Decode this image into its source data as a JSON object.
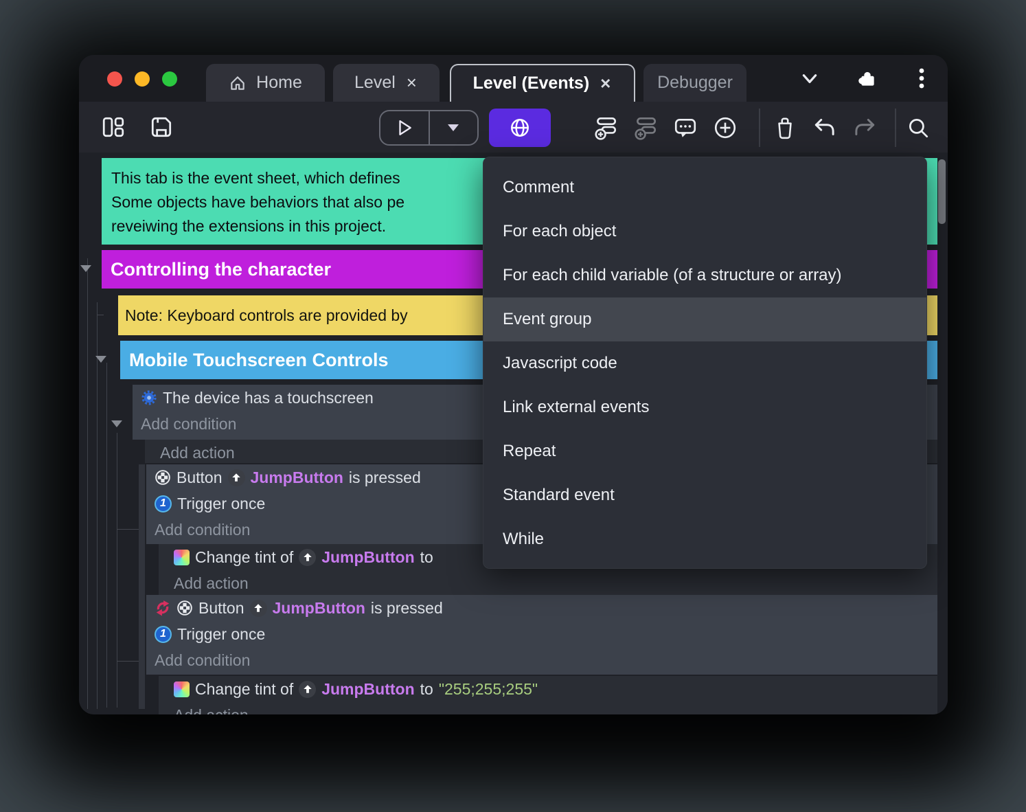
{
  "titlebar": {
    "tabs": [
      {
        "label": "Home"
      },
      {
        "label": "Level",
        "close": "×"
      },
      {
        "label": "Level (Events)",
        "close": "×"
      },
      {
        "label": "Debugger"
      }
    ]
  },
  "menu": {
    "items": [
      {
        "label": "Comment"
      },
      {
        "label": "For each object"
      },
      {
        "label": "For each child variable (of a structure or array)"
      },
      {
        "label": "Event group",
        "highlighted": true
      },
      {
        "label": "Javascript code"
      },
      {
        "label": "Link external events"
      },
      {
        "label": "Repeat"
      },
      {
        "label": "Standard event"
      },
      {
        "label": "While"
      }
    ]
  },
  "sheet": {
    "comment_lines": {
      "line1": "This tab is the event sheet, which defines",
      "line2": "Some objects have behaviors that also pe",
      "line3": "reveiwing the extensions in this project."
    },
    "group_controlling": "Controlling the character",
    "note": "Note: Keyboard controls are provided by",
    "group_mobile": "Mobile Touchscreen Controls",
    "labels": {
      "add_condition": "Add condition",
      "add_action": "Add action"
    },
    "touch_condition": "The device has a touchscreen",
    "button_condition": {
      "prefix": "Button",
      "object": "JumpButton",
      "suffix": "is pressed"
    },
    "trigger_once": "Trigger once",
    "trigger_badge": "1",
    "tint_action": {
      "prefix": "Change tint of",
      "object": "JumpButton",
      "to": "to",
      "value": "\"255;255;255\""
    }
  },
  "colors": {
    "comment_bg": "#4cdcb2",
    "group_controlling_bg": "#bf1fdc",
    "note_bg": "#efd765",
    "group_mobile_bg": "#4aade4",
    "accent_button": "#5b2be0",
    "object_name": "#c87bee",
    "string_value": "#a8cd7f"
  }
}
